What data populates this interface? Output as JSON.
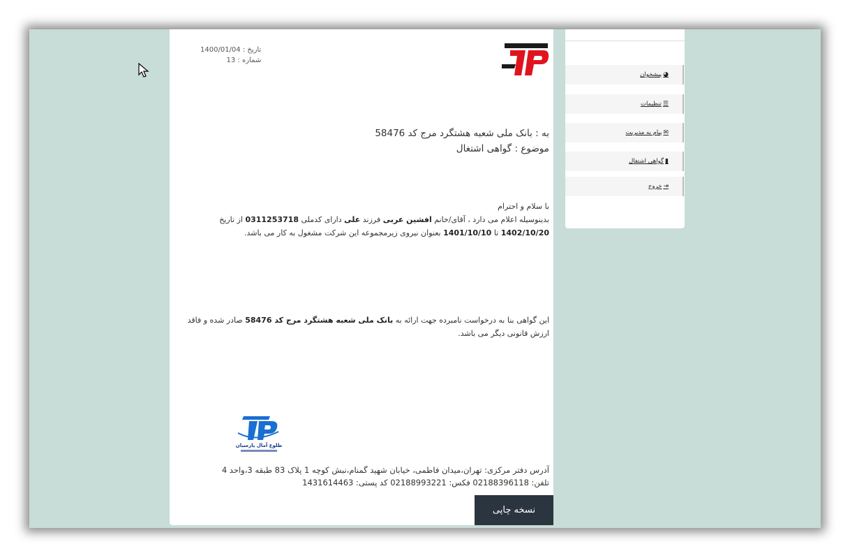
{
  "letter": {
    "date_label": "تاریخ : ",
    "date_value": "1400/01/04",
    "number_label": "شماره : ",
    "number_value": "13",
    "to": "به : بانک ملی شعبه هشتگرد مرج کد 58476",
    "subject": "موضوع : گواهی اشتغال",
    "greeting": "با سلام و احترام",
    "p1_a": "بدینوسیله اعلام می دارد ، آقای/خانم ",
    "employee_name": "افشین عربی",
    "p1_b": " فرزند ",
    "father_name": "علی",
    "p1_c": " دارای کدملی ",
    "national_code": "0311253718",
    "p1_d": " از تاریخ ",
    "start_date": "1402/10/20",
    "p1_e": " تا ",
    "end_date": "1401/10/10",
    "p1_f": " بعنوان نیروی زیرمجموعه این شرکت مشغول به کار می باشد.",
    "p2_a": "این گواهی بنا به درخواست نامبرده جهت ارائه به ",
    "recipient": "بانک ملی شعبه هشتگرد مرج کد 58476",
    "p2_b": " صادر شده و فاقد ارزش قانونی دیگر می باشد.",
    "address": "آدرس دفتر مرکزی: تهران،میدان فاطمی، خیابان شهید گمنام،نبش کوچه 1 پلاک 83 طبقه 3،واحد 4",
    "contact": "تلفن: 02188396118 فکس: 02188993221 کد پستی: 1431614463",
    "print_label": "نسخه چاپی",
    "stamp_text": "طلوع آمال پارسیان"
  },
  "sidebar": {
    "items": [
      {
        "label": "پیشخوان",
        "icon": "dashboard-icon"
      },
      {
        "label": "تنظیمات",
        "icon": "list-icon"
      },
      {
        "label": "پیام به مدیریت",
        "icon": "envelope-icon"
      },
      {
        "label": "گواهی اشتغال",
        "icon": "file-icon"
      },
      {
        "label": "خروج",
        "icon": "sign-out-icon"
      }
    ]
  },
  "colors": {
    "background": "#c8dcd8",
    "logo_red": "#e0141e",
    "logo_dark": "#1a1a1a",
    "stamp_blue": "#1a6fd0",
    "button_dark": "#2b3540"
  }
}
